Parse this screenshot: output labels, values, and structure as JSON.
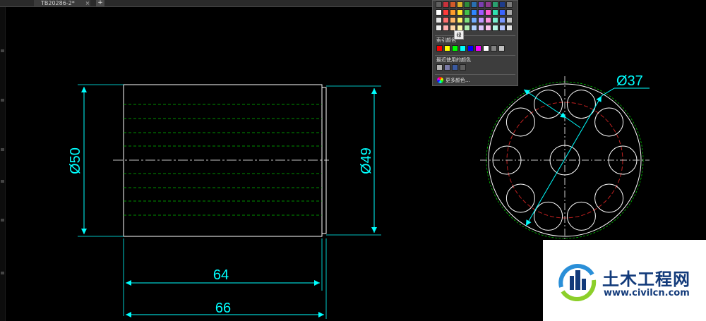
{
  "tabs": {
    "doc_title": "TB20286-2*",
    "close_glyph": "×",
    "add_glyph": "+"
  },
  "palette": {
    "top_rows": [
      [
        "#5f5f5f",
        "#c8323c",
        "#d05a2a",
        "#d8b02a",
        "#2e8b3a",
        "#2a6fb0",
        "#7a3fb0",
        "#8e3b8e",
        "#2aa070",
        "#1e3c8a",
        "#7a7a7a"
      ],
      [
        "#ffffff",
        "#ff3b3b",
        "#ff9c2a",
        "#ffe42a",
        "#43c24a",
        "#2f86ff",
        "#a05aff",
        "#ff5ad0",
        "#2fe0b0",
        "#3a64ff",
        "#a6a6a6"
      ],
      [
        "#e6e6e6",
        "#ff7070",
        "#ffb86a",
        "#fff06a",
        "#7ee07e",
        "#72acff",
        "#c29aff",
        "#ff92e0",
        "#7af0d0",
        "#7a98ff",
        "#c8c8c8"
      ],
      [
        "#f0f0f0",
        "#ffb0b0",
        "#ffd6a6",
        "#fff7a8",
        "#b2f0b2",
        "#b0d0ff",
        "#ddc6ff",
        "#ffc6ee",
        "#b6f8e6",
        "#b6c6ff",
        "#e2e2e2"
      ]
    ],
    "index_label": "索引颜色",
    "index_colors": [
      "#ff0000",
      "#ffff00",
      "#00ff00",
      "#00ffff",
      "#0000ff",
      "#ff00ff",
      "#ffffff",
      "#808080",
      "#c0c0c0"
    ],
    "recent_label": "最近使用的颜色",
    "recent_colors": [
      "#b4b4b4",
      "#7a7aa6",
      "#3a5aa0",
      "#5f5f5f"
    ],
    "more_label": "更多颜色...",
    "tooltip": "绿"
  },
  "colors": {
    "dim": "#00ffff",
    "outline": "#ffffff",
    "hidden": "#00c000",
    "center": "#c02020"
  },
  "drawing": {
    "dim_width_50": "Ø50",
    "dim_width_49": "Ø49",
    "dim_length_64": "64",
    "dim_length_66": "66",
    "dim_bore_37": "Ø37"
  },
  "watermark": {
    "cn": "土木工程网",
    "url": "www.civilcn.com"
  }
}
